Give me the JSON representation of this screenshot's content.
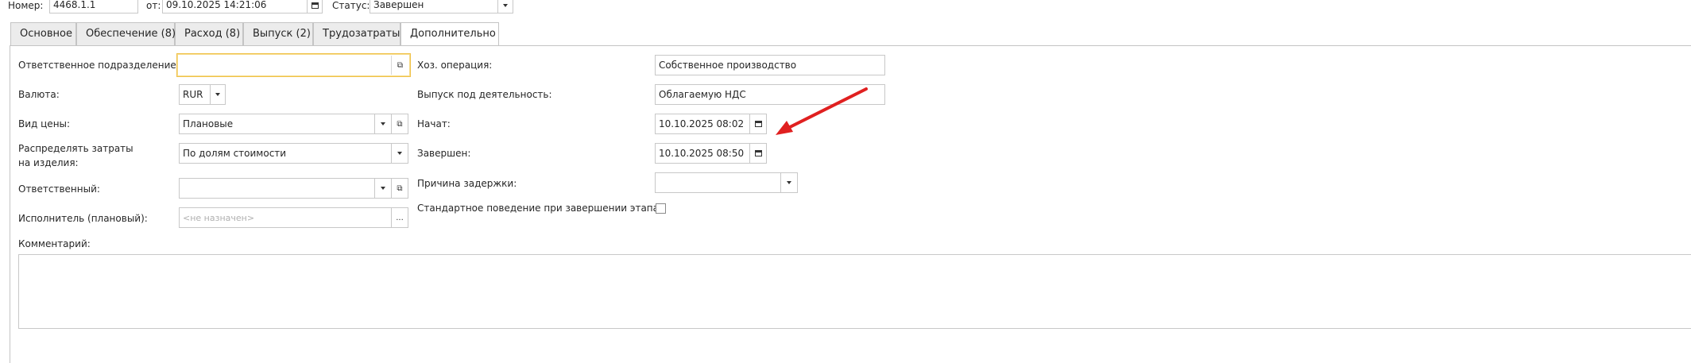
{
  "header": {
    "number_label": "Номер:",
    "number_value": "4468.1.1",
    "from_label": "от:",
    "date_value": "09.10.2025 14:21:06",
    "status_label": "Статус:",
    "status_value": "Завершен"
  },
  "tabs": [
    {
      "label": "Основное"
    },
    {
      "label": "Обеспечение (8)"
    },
    {
      "label": "Расход (8)"
    },
    {
      "label": "Выпуск (2)"
    },
    {
      "label": "Трудозатраты"
    },
    {
      "label": "Дополнительно"
    }
  ],
  "active_tab": "Дополнительно",
  "left": {
    "responsible_dept_label": "Ответственное подразделение:",
    "responsible_dept_value": "",
    "currency_label": "Валюта:",
    "currency_value": "RUR",
    "price_type_label": "Вид цены:",
    "price_type_value": "Плановые",
    "distribute_label_1": "Распределять затраты",
    "distribute_label_2": "на изделия:",
    "distribute_value": "По долям стоимости",
    "responsible_label": "Ответственный:",
    "responsible_value": "",
    "executor_label": "Исполнитель (плановый):",
    "executor_placeholder": "<не назначен>",
    "executor_button": "...",
    "comment_label": "Комментарий:",
    "comment_value": ""
  },
  "right": {
    "operation_label": "Хоз. операция:",
    "operation_value": "Собственное производство",
    "activity_label": "Выпуск под деятельность:",
    "activity_value": "Облагаемую НДС",
    "started_label": "Начат:",
    "started_value": "10.10.2025 08:02",
    "finished_label": "Завершен:",
    "finished_value": "10.10.2025 08:50",
    "delay_reason_label": "Причина задержки:",
    "delay_reason_value": "",
    "standard_behavior_label": "Стандартное поведение при завершении этапа:",
    "standard_behavior_checked": false
  },
  "annotation": {
    "arrow_color": "#e02020"
  }
}
